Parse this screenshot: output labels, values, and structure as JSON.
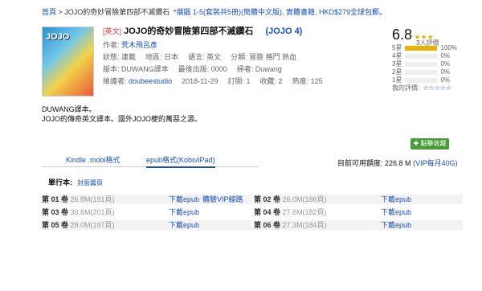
{
  "breadcrumb": {
    "home": "首頁",
    "title": "JOJO的奇妙冒險第四部不滅鑽石"
  },
  "promo": "端腦 1-5(套裝共5冊)(簡體中文版), 實體書籍, HKD$279全球包郵。",
  "book": {
    "lang_tag": "[英文]",
    "title": "JOJO的奇妙冒險第四部不滅鑽石",
    "alt_title": "(JOJO 4)",
    "author_label": "作者:",
    "author": "荒木飛呂彥",
    "status_label": "狀態:",
    "status": "連載",
    "region_label": "地區:",
    "region": "日本",
    "language_label": "語言:",
    "language": "英文",
    "genre_label": "分類:",
    "genres": "冒險 格鬥 熱血",
    "version_label": "版本:",
    "version": "DUWANG譯本",
    "latest_label": "最後出版:",
    "latest": "0000",
    "scanner_label": "掃者:",
    "scanner": "Duwang",
    "maintainer_label": "維護者:",
    "maintainer": "doubeestudio",
    "updated": "2018-11-29",
    "subs_label": "訂閱:",
    "subs": "1",
    "fav_label": "收藏:",
    "fav": "2",
    "heat_label": "熱度:",
    "heat": "125"
  },
  "rating": {
    "score": "6.8",
    "stars": "★★★",
    "voters": "3人評價",
    "my_label": "我的評價:",
    "my_stars": "☆☆☆☆☆",
    "levels": [
      {
        "label": "5星",
        "pct": 100
      },
      {
        "label": "4星",
        "pct": 0
      },
      {
        "label": "3星",
        "pct": 0
      },
      {
        "label": "2星",
        "pct": 0
      },
      {
        "label": "1星",
        "pct": 0
      }
    ]
  },
  "description": [
    "DUWANG譯本。",
    "JOJO的傳奇英文譯本。國外JOJO梗的萬惡之源。"
  ],
  "favorite_button": "點擊收藏",
  "tabs": [
    "Kindle .mobi格式",
    "epub格式(Kobo/iPad)"
  ],
  "quota": {
    "label": "目前可用額度:",
    "value": "226.8 M",
    "vip": "(VIP每月40G)"
  },
  "section": {
    "title": "單行本:",
    "sort": "封面醬賀"
  },
  "volumes_left": [
    {
      "num": "第 01 卷",
      "size": "26.8M(191頁)",
      "dl": "下載epub",
      "vip": "體驗VIP線路"
    },
    {
      "num": "第 03 卷",
      "size": "30.6M(201頁)",
      "dl": "下載epub"
    },
    {
      "num": "第 05 卷",
      "size": "29.0M(197頁)",
      "dl": "下載epub"
    }
  ],
  "volumes_right": [
    {
      "num": "第 02 卷",
      "size": "26.0M(186頁)",
      "dl": "下載epub"
    },
    {
      "num": "第 04 卷",
      "size": "27.6M(182頁)",
      "dl": "下載epub"
    },
    {
      "num": "第 06 卷",
      "size": "27.3M(184頁)",
      "dl": "下載epub"
    }
  ]
}
